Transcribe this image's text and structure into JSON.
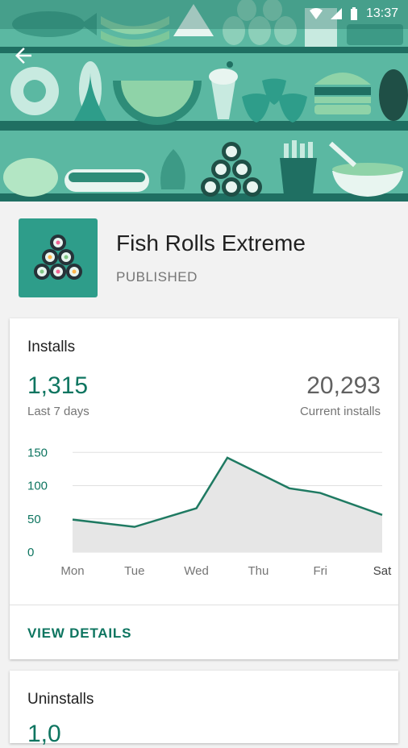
{
  "status_bar": {
    "time": "13:37"
  },
  "colors": {
    "accent": "#0e7560",
    "header_bg": "#5bb8a2",
    "icon_bg": "#2e9d8a"
  },
  "header": {
    "back_icon": "arrow-back-icon"
  },
  "app": {
    "name": "Fish Rolls Extreme",
    "status": "PUBLISHED"
  },
  "installs_card": {
    "title": "Installs",
    "primary_value": "1,315",
    "primary_label": "Last 7 days",
    "secondary_value": "20,293",
    "secondary_label": "Current installs",
    "action": "VIEW DETAILS"
  },
  "uninstalls_card": {
    "title": "Uninstalls",
    "partial_value": "1,0"
  },
  "chart_data": {
    "type": "area",
    "categories": [
      "Mon",
      "Tue",
      "Wed",
      "Thu",
      "Fri",
      "Sat"
    ],
    "values": [
      49,
      38,
      66,
      142,
      96,
      89,
      56
    ],
    "x_points": [
      "Mon",
      "Tue",
      "Wed",
      "Wed-Thu",
      "Thu-Fri",
      "Fri",
      "Sat"
    ],
    "yticks": [
      0,
      50,
      100,
      150
    ],
    "ylim": [
      0,
      160
    ],
    "grid": true
  }
}
